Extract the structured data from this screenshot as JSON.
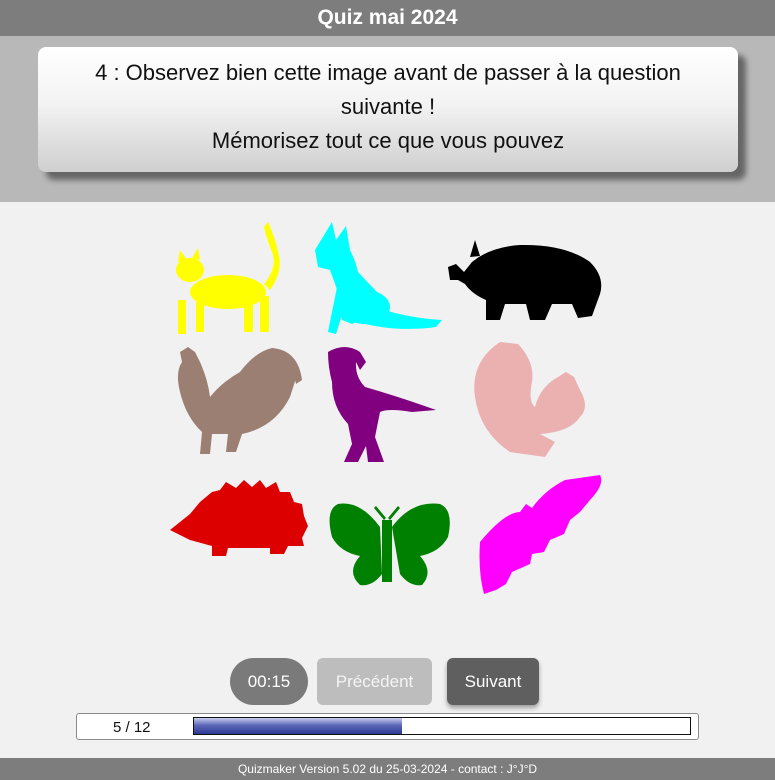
{
  "header": {
    "title": "Quiz mai 2024"
  },
  "question": {
    "line1": "4 : Observez bien cette image avant de passer à la question",
    "line2": "suivante !",
    "line3": "Mémorisez tout ce que vous pouvez"
  },
  "image": {
    "animals": [
      {
        "name": "cat",
        "color": "#ffff00"
      },
      {
        "name": "dog",
        "color": "#00ffff"
      },
      {
        "name": "rhinoceros",
        "color": "#000000"
      },
      {
        "name": "rooster",
        "color": "#9b7f72"
      },
      {
        "name": "eagle",
        "color": "#800080"
      },
      {
        "name": "squirrel",
        "color": "#ebb0b0"
      },
      {
        "name": "hedgehog",
        "color": "#dd0000"
      },
      {
        "name": "butterfly",
        "color": "#008000"
      },
      {
        "name": "bat",
        "color": "#ff00ff"
      }
    ]
  },
  "controls": {
    "timer": "00:15",
    "prev_label": "Précédent",
    "next_label": "Suivant"
  },
  "progress": {
    "label": "5 / 12",
    "current": 5,
    "total": 12,
    "fraction": 0.42
  },
  "footer": {
    "text": "Quizmaker Version 5.02 du 25-03-2024 - contact : J°J°D"
  },
  "colors": {
    "header_bg": "#7d7d7d",
    "band_bg": "#b8b8b8",
    "page_bg": "#f1f1f1",
    "progress_fill": "#3f4aa3"
  }
}
